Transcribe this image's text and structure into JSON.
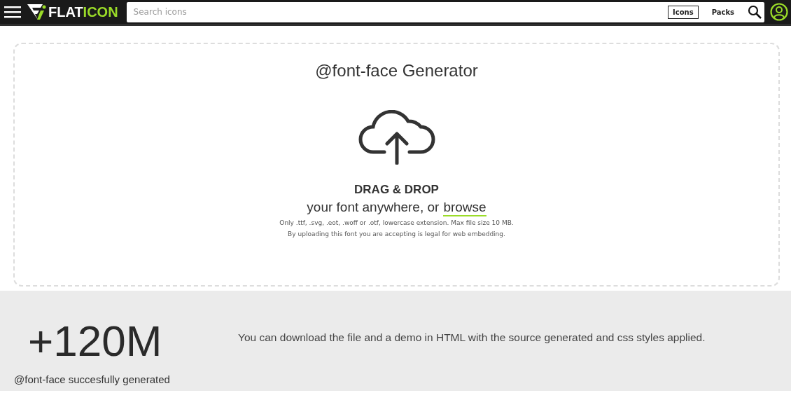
{
  "header": {
    "logo": {
      "first": "FLAT",
      "second": "ICON"
    },
    "search": {
      "placeholder": "Search icons"
    },
    "tabs": [
      {
        "label": "Icons",
        "selected": true
      },
      {
        "label": "Packs",
        "selected": false
      }
    ]
  },
  "upload": {
    "title": "@font-face Generator",
    "heading": "DRAG & DROP",
    "prompt": "your font anywhere, or",
    "link": "browse",
    "notes": [
      "Only .ttf, .svg, .eot, .woff or .otf, lowercase extension. Max file size 10 MB.",
      "By uploading this font you are accepting is legal for web embedding."
    ]
  },
  "stats": {
    "count": "+120M",
    "caption": "@font-face succesfully generated",
    "description": "You can download the file and a demo in HTML with the source generated and css styles applied."
  }
}
